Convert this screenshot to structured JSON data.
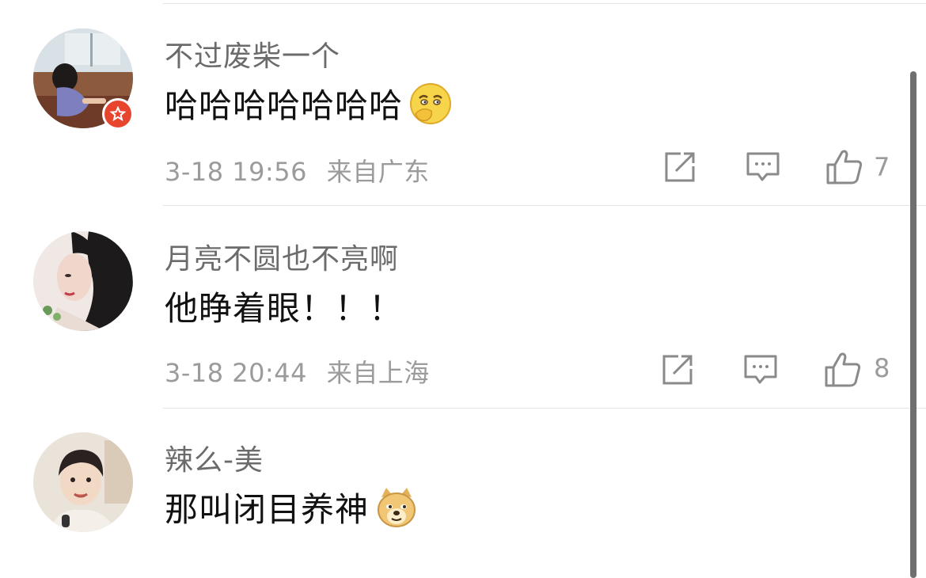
{
  "comments": [
    {
      "username": "不过废柴一个",
      "text": "哈哈哈哈哈哈哈",
      "emoji": "thinking-smile-emoji",
      "timestamp": "3-18 19:56",
      "location": "来自广东",
      "likes": "7",
      "verified": true
    },
    {
      "username": "月亮不圆也不亮啊",
      "text": "他睁着眼！！！",
      "emoji": "",
      "timestamp": "3-18 20:44",
      "location": "来自上海",
      "likes": "8",
      "verified": false
    },
    {
      "username": "辣么-美",
      "text": "那叫闭目养神",
      "emoji": "doge-emoji",
      "timestamp": "",
      "location": "",
      "likes": "",
      "verified": false
    }
  ],
  "colors": {
    "badge": "#e8452f",
    "meta": "#9b9b9b",
    "username": "#6b6b6b",
    "text": "#111111"
  }
}
